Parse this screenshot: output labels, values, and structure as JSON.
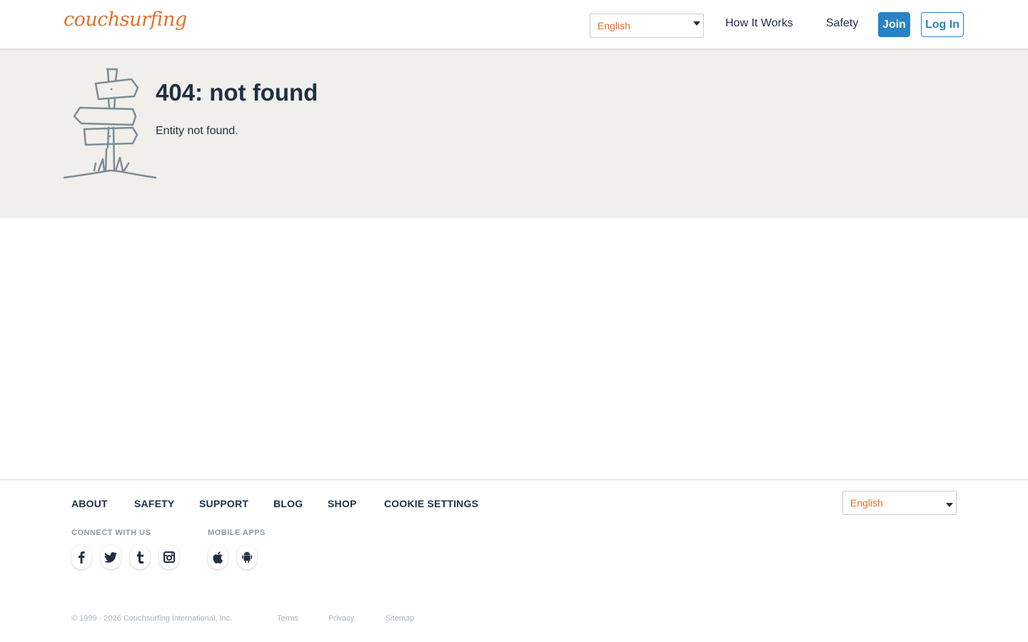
{
  "header": {
    "logo_text": "couchsurfing",
    "language_value": "English",
    "nav": {
      "how_it_works": "How It Works",
      "safety": "Safety"
    },
    "join_label": "Join",
    "login_label": "Log In"
  },
  "hero": {
    "title": "404: not found",
    "message": "Entity not found."
  },
  "footer": {
    "links": [
      "ABOUT",
      "SAFETY",
      "SUPPORT",
      "BLOG",
      "SHOP",
      "COOKIE SETTINGS"
    ],
    "connect_heading": "CONNECT WITH US",
    "apps_heading": "MOBILE APPS",
    "social_icons": [
      "facebook-icon",
      "twitter-icon",
      "tumblr-icon",
      "instagram-icon"
    ],
    "app_icons": [
      "apple-icon",
      "android-icon"
    ],
    "language_value": "English",
    "copyright": "© 1999 - 2026 Couchsurfing International, Inc.",
    "legal": {
      "terms": "Terms",
      "privacy": "Privacy",
      "sitemap": "Sitemap"
    }
  },
  "colors": {
    "brand_orange": "#e4702b",
    "primary_blue": "#2a83c2",
    "text_navy": "#1e2f45",
    "hero_bg": "#f0efeb"
  }
}
